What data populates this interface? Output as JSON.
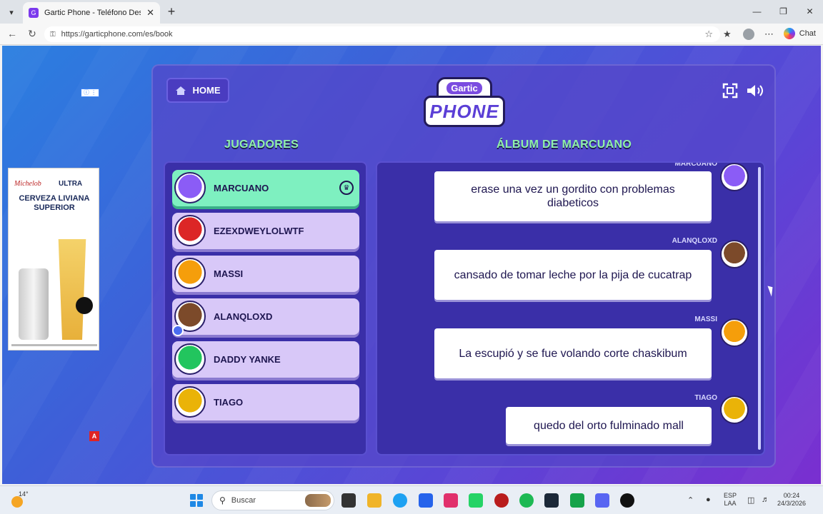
{
  "browser": {
    "tab_title": "Gartic Phone - Teléfono Descompues",
    "url": "https://garticphone.com/es/book",
    "chat_label": "Chat"
  },
  "page": {
    "home_label": "HOME",
    "logo_top": "Gartic",
    "logo_bottom": "PHONE",
    "players_title": "JUGADORES",
    "album_title": "ÁLBUM DE MARCUANO"
  },
  "ad": {
    "brand": "Michelob",
    "product": "ULTRA",
    "headline": "CERVEZA LIVIANA SUPERIOR",
    "choice_label": "A"
  },
  "players": [
    {
      "name": "MARCUANO",
      "active": true,
      "host": true,
      "avatar_color": "#8b5cf6"
    },
    {
      "name": "EZEXDWEYLOLWTF",
      "active": false,
      "host": false,
      "avatar_color": "#dc2626"
    },
    {
      "name": "MASSI",
      "active": false,
      "host": false,
      "avatar_color": "#f59e0b"
    },
    {
      "name": "ALANQLOXD",
      "active": false,
      "host": false,
      "avatar_color": "#7c4a2a"
    },
    {
      "name": "DADDY YANKE",
      "active": false,
      "host": false,
      "avatar_color": "#22c55e"
    },
    {
      "name": "TIAGO",
      "active": false,
      "host": false,
      "avatar_color": "#eab308"
    }
  ],
  "album": [
    {
      "author": "MARCUANO",
      "text": "erase una vez un gordito con problemas diabeticos",
      "avatar_color": "#8b5cf6"
    },
    {
      "author": "ALANQLOXD",
      "text": "cansado de tomar leche por la pija de cucatrap",
      "avatar_color": "#7c4a2a"
    },
    {
      "author": "MASSI",
      "text": "La escupió y se fue volando corte chaskibum",
      "avatar_color": "#f59e0b"
    },
    {
      "author": "TIAGO",
      "text": "quedo del orto fulminado mall",
      "avatar_color": "#eab308"
    }
  ],
  "taskbar": {
    "weather_temp": "14°",
    "search_placeholder": "Buscar",
    "lang_line1": "ESP",
    "lang_line2": "LAA",
    "time": "00:24",
    "date": "24/3/2026"
  }
}
